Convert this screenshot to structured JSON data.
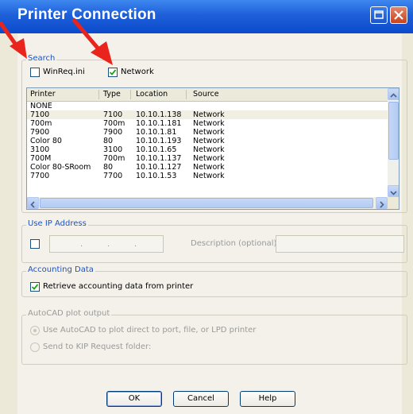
{
  "window": {
    "title": "Printer Connection"
  },
  "search": {
    "label": "Search",
    "winreq_label": "WinReq.ini",
    "winreq_checked": false,
    "network_label": "Network",
    "network_checked": true
  },
  "table": {
    "columns": [
      "Printer",
      "Type",
      "Location",
      "Source"
    ],
    "rows": [
      [
        "NONE",
        "",
        "",
        ""
      ],
      [
        "7100",
        "7100",
        "10.10.1.138",
        "Network"
      ],
      [
        "700m",
        "700m",
        "10.10.1.181",
        "Network"
      ],
      [
        "7900",
        "7900",
        "10.10.1.81",
        "Network"
      ],
      [
        "Color 80",
        "80",
        "10.10.1.193",
        "Network"
      ],
      [
        "3100",
        "3100",
        "10.10.1.65",
        "Network"
      ],
      [
        "700M",
        "700m",
        "10.10.1.137",
        "Network"
      ],
      [
        "Color 80-SRoom",
        "80",
        "10.10.1.127",
        "Network"
      ],
      [
        "7700",
        "7700",
        "10.10.1.53",
        "Network"
      ]
    ],
    "selected_index": 1
  },
  "ip": {
    "label": "Use IP Address",
    "checked": false,
    "dots": [
      ".",
      ".",
      "."
    ],
    "description_label": "Description (optional):"
  },
  "accounting": {
    "label": "Accounting Data",
    "checked": true,
    "retrieve_label": "Retrieve accounting data from printer"
  },
  "autocad": {
    "label": "AutoCAD plot output",
    "option1": "Use AutoCAD to plot direct to port, file, or LPD printer",
    "option2": "Send to KIP Request folder:"
  },
  "buttons": {
    "ok": "OK",
    "cancel": "Cancel",
    "help": "Help"
  },
  "colors": {
    "arrow": "#e8241c",
    "titlebar": "#0b4bcc",
    "group_label": "#1c53c5"
  }
}
